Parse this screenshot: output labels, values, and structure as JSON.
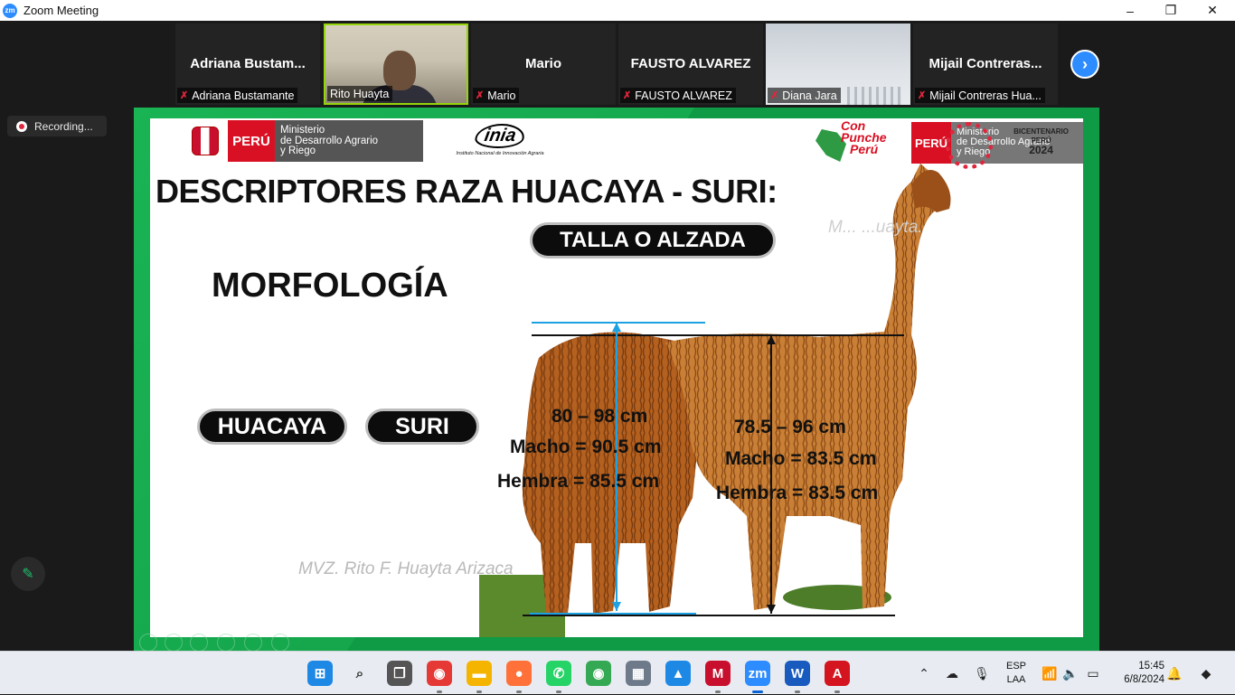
{
  "window": {
    "app_icon": "zm",
    "title": "Zoom Meeting",
    "controls": {
      "minimize": "–",
      "maximize": "❐",
      "close": "✕"
    }
  },
  "participants": [
    {
      "big_name": "Adriana  Bustam...",
      "label": "Adriana Bustamante",
      "muted": true,
      "video": false
    },
    {
      "big_name": "",
      "label": "Rito Huayta",
      "muted": false,
      "video": true
    },
    {
      "big_name": "Mario",
      "label": "Mario",
      "muted": true,
      "video": false
    },
    {
      "big_name": "FAUSTO ALVAREZ",
      "label": "FAUSTO ALVAREZ",
      "muted": true,
      "video": false
    },
    {
      "big_name": "",
      "label": "Diana Jara",
      "muted": true,
      "video": true
    },
    {
      "big_name": "Mijail  Contreras...",
      "label": "Mijail Contreras Hua...",
      "muted": true,
      "video": false
    }
  ],
  "gallery_next_icon": "chevron-right-icon",
  "recording": {
    "label": "Recording..."
  },
  "annotate": {
    "icon": "pencil-icon"
  },
  "slide": {
    "logo_left": {
      "country": "PERÚ",
      "ministry_lines": [
        "Ministerio",
        "de Desarrollo Agrario",
        "y Riego"
      ]
    },
    "inia": {
      "mark": "inia",
      "subtitle": "Instituto Nacional de Innovación Agraria"
    },
    "con_punche": [
      "Con",
      "Punche",
      "Perú"
    ],
    "logo_right": {
      "country": "PERÚ",
      "ministry_lines": [
        "Ministerio",
        "de Desarrollo Agrario",
        "y Riego"
      ],
      "bicentenario": "BICENTENARIO",
      "bicentenario_sub": "PERÚ",
      "year": "2024"
    },
    "title": "DESCRIPTORES RAZA HUACAYA - SURI:",
    "subtitle_pill": "TALLA O ALZADA",
    "section": "MORFOLOGÍA",
    "pill_huacaya": "HUACAYA",
    "pill_suri": "SURI",
    "watermark_bottom": "MVZ. Rito F. Huayta Arizaca",
    "watermark_top": "M...            ...uayta.",
    "suri_measures": {
      "range": "80 – 98 cm",
      "macho": "Macho = 90.5 cm",
      "hembra": "Hembra = 85.5 cm"
    },
    "huacaya_measures": {
      "range": "78.5 – 96 cm",
      "macho": "Macho = 83.5 cm",
      "hembra": "Hembra = 83.5 cm"
    }
  },
  "taskbar": {
    "apps": [
      {
        "name": "start",
        "icon": "windows-icon",
        "color": "#1e88e5"
      },
      {
        "name": "search",
        "icon": "search-icon",
        "color": "#333333"
      },
      {
        "name": "task-view",
        "icon": "task-view-icon",
        "color": "#555555"
      },
      {
        "name": "chrome",
        "icon": "chrome-icon",
        "color": "#e53935"
      },
      {
        "name": "file-explorer",
        "icon": "folder-icon",
        "color": "#f4b400"
      },
      {
        "name": "firefox",
        "icon": "firefox-icon",
        "color": "#ff7139"
      },
      {
        "name": "whatsapp",
        "icon": "whatsapp-icon",
        "color": "#25d366"
      },
      {
        "name": "chrome-2",
        "icon": "chrome-icon",
        "color": "#34a853"
      },
      {
        "name": "calculator",
        "icon": "calculator-icon",
        "color": "#6e7a8a"
      },
      {
        "name": "photos",
        "icon": "photos-icon",
        "color": "#1e88e5"
      },
      {
        "name": "mcafee",
        "icon": "mcafee-icon",
        "color": "#c8102e"
      },
      {
        "name": "zoom",
        "icon": "zoom-icon",
        "color": "#2d8cff"
      },
      {
        "name": "word",
        "icon": "word-icon",
        "color": "#185abd"
      },
      {
        "name": "acrobat",
        "icon": "acrobat-icon",
        "color": "#d4141f"
      }
    ],
    "language": {
      "line1": "ESP",
      "line2": "LAA"
    },
    "clock": {
      "time": "15:45",
      "date": "6/8/2024"
    }
  }
}
